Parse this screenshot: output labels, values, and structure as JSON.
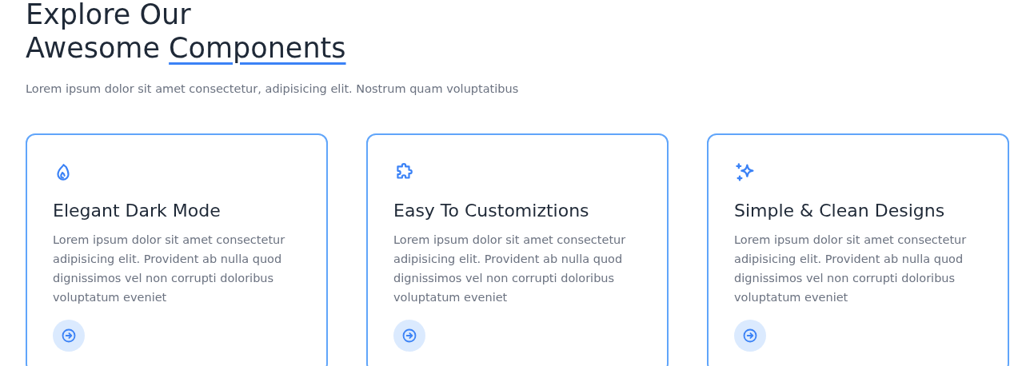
{
  "heading": {
    "lines": [
      "Explore Our",
      "Awesome"
    ],
    "highlight": "Components"
  },
  "intro": "Lorem ipsum dolor sit amet consectetur, adipisicing elit. Nostrum quam voluptatibus",
  "cards": [
    {
      "kind": "flame",
      "title": "Elegant Dark Mode",
      "text": "Lorem ipsum dolor sit amet consectetur adipisicing elit. Provident ab nulla quod dignissimos vel non corrupti doloribus voluptatum eveniet"
    },
    {
      "kind": "puzzle",
      "title": "Easy To Customiztions",
      "text": "Lorem ipsum dolor sit amet consectetur adipisicing elit. Provident ab nulla quod dignissimos vel non corrupti doloribus voluptatum eveniet"
    },
    {
      "kind": "sparkles",
      "title": "Simple & Clean Designs",
      "text": "Lorem ipsum dolor sit amet consectetur adipisicing elit. Provident ab nulla quod dignissimos vel non corrupti doloribus voluptatum eveniet"
    }
  ]
}
